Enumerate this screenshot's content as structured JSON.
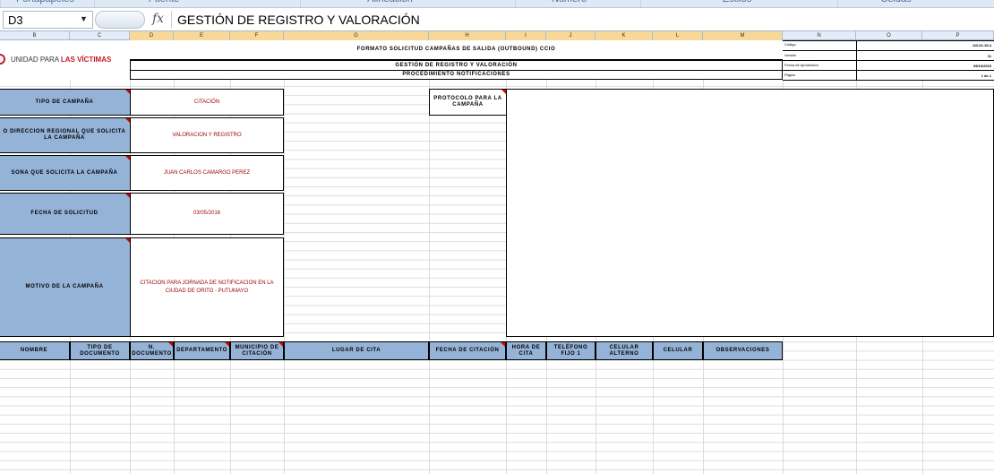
{
  "ribbon": {
    "groups": [
      "Portapapeles",
      "Fuente",
      "Alineación",
      "Número",
      "Estilos",
      "Celdas"
    ]
  },
  "formula_bar": {
    "name_box": "D3",
    "content": "GESTIÓN DE REGISTRO Y VALORACIÓN"
  },
  "columns": [
    "B",
    "C",
    "D",
    "E",
    "F",
    "G",
    "H",
    "I",
    "J",
    "K",
    "L",
    "M",
    "N",
    "O",
    "P"
  ],
  "selected_column": "D",
  "header": {
    "logo_prefix": "UNIDAD PARA ",
    "logo_bold": "LAS VÍCTIMAS",
    "line1": "FORMATO SOLICITUD CAMPAÑAS DE SALIDA (OUTBOUND) CCIO",
    "line2": "GESTIÓN DE REGISTRO Y VALORACIÓN",
    "line3": "PROCEDIMIENTO NOTIFICACIONES",
    "meta_labels": [
      "Código",
      "Versión",
      "Fecha de Aprobación",
      "Página"
    ],
    "meta_values": [
      "110.01.15-4",
      "01",
      "05/10/2015",
      "1 de 1"
    ]
  },
  "form": {
    "tipo_label": "TIPO DE CAMPAÑA",
    "tipo_value": "CITACIÓN",
    "direccion_label": "O DIRECCION REGIONAL QUE SOLICITA LA CAMPAÑA",
    "direccion_value": "VALORACION Y REGISTRO",
    "persona_label": "SONA QUE SOLICITA LA CAMPAÑA",
    "persona_value": "JUAN CARLOS CAMARGO PEREZ",
    "fecha_label": "FECHA DE SOLICITUD",
    "fecha_value": "03/05/2016",
    "motivo_label": "MOTIVO DE LA CAMPAÑA",
    "motivo_value": "CITACION PARA JORNADA DE NOTIFICACION EN LA CIUDAD DE ORITO - PUTUMAYO",
    "protocolo_label": "PROTOCOLO PARA LA CAMPAÑA"
  },
  "table_headers": [
    "NOMBRE",
    "TIPO DE DOCUMENTO",
    "N. DOCUMENTO",
    "DEPARTAMENTO",
    "MUNICIPIO DE CITACIÓN",
    "LUGAR DE CITA",
    "FECHA DE CITACIÓN",
    "HORA DE CITA",
    "TELÉFONO FIJO 1",
    "CELULAR ALTERNO",
    "CELULAR",
    "OBSERVACIONES"
  ]
}
